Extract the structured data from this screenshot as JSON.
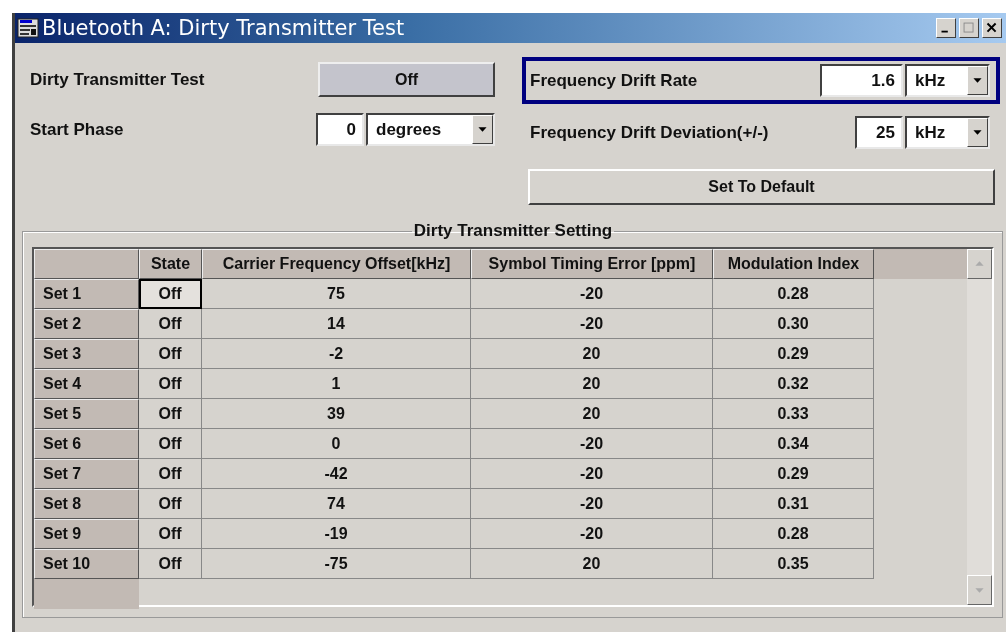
{
  "window": {
    "title": "Bluetooth A: Dirty Transmitter Test"
  },
  "left_settings": [
    {
      "kind": "toggle",
      "label": "Dirty Transmitter Test",
      "value": "Off"
    },
    {
      "kind": "value_unit",
      "label": "Start Phase",
      "value": "0",
      "unit": "degrees"
    }
  ],
  "right_settings": [
    {
      "kind": "value_unit",
      "label": "Frequency Drift Rate",
      "value": "1.6",
      "unit": "kHz",
      "focused": true
    },
    {
      "kind": "value_unit",
      "label": "Frequency Drift Deviation(+/-)",
      "value": "25",
      "unit": "kHz",
      "focused": false
    }
  ],
  "default_button": "Set To Default",
  "table": {
    "title": "Dirty Transmitter Setting",
    "columns": [
      "",
      "State",
      "Carrier Frequency Offset[kHz]",
      "Symbol Timing Error [ppm]",
      "Modulation Index"
    ],
    "rows": [
      {
        "focused": true,
        "cells": [
          "Set 1",
          "Off",
          "75",
          "-20",
          "0.28"
        ]
      },
      {
        "focused": false,
        "cells": [
          "Set 2",
          "Off",
          "14",
          "-20",
          "0.30"
        ]
      },
      {
        "focused": false,
        "cells": [
          "Set 3",
          "Off",
          "-2",
          "20",
          "0.29"
        ]
      },
      {
        "focused": false,
        "cells": [
          "Set 4",
          "Off",
          "1",
          "20",
          "0.32"
        ]
      },
      {
        "focused": false,
        "cells": [
          "Set 5",
          "Off",
          "39",
          "20",
          "0.33"
        ]
      },
      {
        "focused": false,
        "cells": [
          "Set 6",
          "Off",
          "0",
          "-20",
          "0.34"
        ]
      },
      {
        "focused": false,
        "cells": [
          "Set 7",
          "Off",
          "-42",
          "-20",
          "0.29"
        ]
      },
      {
        "focused": false,
        "cells": [
          "Set 8",
          "Off",
          "74",
          "-20",
          "0.31"
        ]
      },
      {
        "focused": false,
        "cells": [
          "Set 9",
          "Off",
          "-19",
          "-20",
          "0.28"
        ]
      },
      {
        "focused": false,
        "cells": [
          "Set 10",
          "Off",
          "-75",
          "20",
          "0.35"
        ]
      }
    ]
  }
}
